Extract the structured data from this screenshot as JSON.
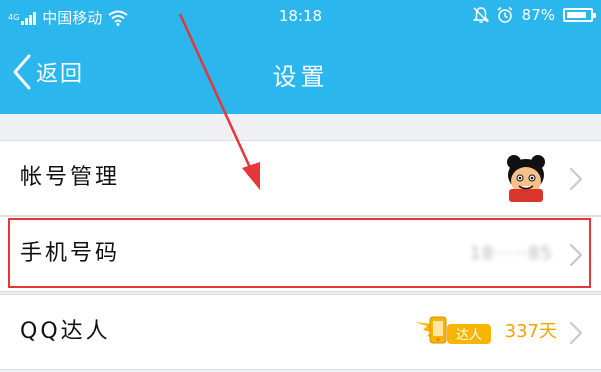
{
  "status_bar": {
    "network_type": "4G",
    "carrier": "中国移动",
    "time": "18:18",
    "battery_percent": "87%",
    "battery_level": 0.87
  },
  "nav": {
    "back_label": "返回",
    "title": "设置"
  },
  "settings": {
    "items": [
      {
        "label": "帐号管理"
      },
      {
        "label": "手机号码",
        "value": "18·····85"
      },
      {
        "label": "QQ达人",
        "badge_text": "达人",
        "value": "337天"
      }
    ]
  },
  "colors": {
    "header": "#2bb6ee",
    "highlight": "#e5363c",
    "accent_orange": "#f5a300"
  }
}
